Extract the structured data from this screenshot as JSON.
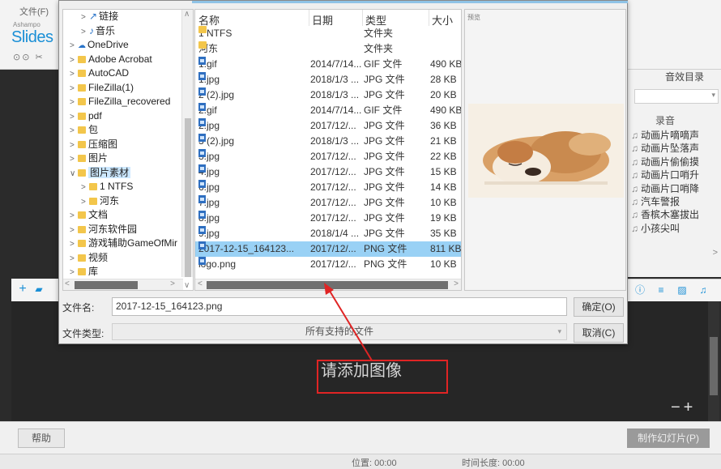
{
  "app": {
    "file_menu": "文件(F)",
    "brand_small": "Ashampo",
    "brand": "Slides",
    "controls": "⊙⊙ ✂",
    "sfx_title": "音效目录",
    "sfx_header": "录音",
    "sfx_items": [
      "动画片嘀嘀声",
      "动画片坠落声",
      "动画片偷偷摸",
      "动画片口哨升",
      "动画片口哨降",
      "汽车警报",
      "香槟木塞拔出",
      "小孩尖叫"
    ],
    "placeholder": "请添加图像",
    "zoom": "−+",
    "help_button": "帮助",
    "make_button": "制作幻灯片(P)",
    "status_position": "位置: 00:00",
    "status_duration": "时间长度: 00:00"
  },
  "dialog": {
    "tree": [
      {
        "label": "链接",
        "kind": "shortcut",
        "indent": 2,
        "chev": ">"
      },
      {
        "label": "音乐",
        "kind": "music",
        "indent": 2,
        "chev": ">"
      },
      {
        "label": "OneDrive",
        "kind": "cloud",
        "indent": 1,
        "chev": ">"
      },
      {
        "label": "Adobe Acrobat",
        "kind": "folder",
        "indent": 1,
        "chev": ">"
      },
      {
        "label": "AutoCAD",
        "kind": "folder",
        "indent": 1,
        "chev": ">"
      },
      {
        "label": "FileZilla(1)",
        "kind": "folder",
        "indent": 1,
        "chev": ">"
      },
      {
        "label": "FileZilla_recovered",
        "kind": "folder",
        "indent": 1,
        "chev": ">"
      },
      {
        "label": "pdf",
        "kind": "folder",
        "indent": 1,
        "chev": ">"
      },
      {
        "label": "包",
        "kind": "folder",
        "indent": 1,
        "chev": ">"
      },
      {
        "label": "压缩图",
        "kind": "folder",
        "indent": 1,
        "chev": ">"
      },
      {
        "label": "图片",
        "kind": "folder",
        "indent": 1,
        "chev": ">"
      },
      {
        "label": "图片素材",
        "kind": "folder",
        "indent": 1,
        "chev": "∨",
        "selected": true
      },
      {
        "label": "1 NTFS",
        "kind": "folder",
        "indent": 2,
        "chev": ">"
      },
      {
        "label": "河东",
        "kind": "folder",
        "indent": 2,
        "chev": ">"
      },
      {
        "label": "文档",
        "kind": "folder",
        "indent": 1,
        "chev": ">"
      },
      {
        "label": "河东软件园",
        "kind": "folder",
        "indent": 1,
        "chev": ">"
      },
      {
        "label": "游戏辅助GameOfMir",
        "kind": "folder",
        "indent": 1,
        "chev": ">"
      },
      {
        "label": "视频",
        "kind": "folder",
        "indent": 1,
        "chev": ">"
      },
      {
        "label": "库",
        "kind": "folder",
        "indent": 1,
        "chev": ">"
      }
    ],
    "columns": {
      "name": "名称",
      "date": "日期",
      "type": "类型",
      "size": "大小"
    },
    "files": [
      {
        "name": "1 NTFS",
        "date": "",
        "type": "文件夹",
        "size": "",
        "icon": "folder"
      },
      {
        "name": "河东",
        "date": "",
        "type": "文件夹",
        "size": "",
        "icon": "folder"
      },
      {
        "name": "1.gif",
        "date": "2014/7/14...",
        "type": "GIF 文件",
        "size": "490 KB",
        "icon": "img"
      },
      {
        "name": "1.jpg",
        "date": "2018/1/3 ...",
        "type": "JPG 文件",
        "size": "28 KB",
        "icon": "img"
      },
      {
        "name": "2 (2).jpg",
        "date": "2018/1/3 ...",
        "type": "JPG 文件",
        "size": "20 KB",
        "icon": "img"
      },
      {
        "name": "2.gif",
        "date": "2014/7/14...",
        "type": "GIF 文件",
        "size": "490 KB",
        "icon": "img"
      },
      {
        "name": "2.jpg",
        "date": "2017/12/...",
        "type": "JPG 文件",
        "size": "36 KB",
        "icon": "img"
      },
      {
        "name": "3 (2).jpg",
        "date": "2018/1/3 ...",
        "type": "JPG 文件",
        "size": "21 KB",
        "icon": "img"
      },
      {
        "name": "3.jpg",
        "date": "2017/12/...",
        "type": "JPG 文件",
        "size": "22 KB",
        "icon": "img"
      },
      {
        "name": "4.jpg",
        "date": "2017/12/...",
        "type": "JPG 文件",
        "size": "15 KB",
        "icon": "img"
      },
      {
        "name": "6.jpg",
        "date": "2017/12/...",
        "type": "JPG 文件",
        "size": "14 KB",
        "icon": "img"
      },
      {
        "name": "7.jpg",
        "date": "2017/12/...",
        "type": "JPG 文件",
        "size": "10 KB",
        "icon": "img"
      },
      {
        "name": "8.jpg",
        "date": "2017/12/...",
        "type": "JPG 文件",
        "size": "19 KB",
        "icon": "img"
      },
      {
        "name": "9.jpg",
        "date": "2018/1/4 ...",
        "type": "JPG 文件",
        "size": "35 KB",
        "icon": "img"
      },
      {
        "name": "2017-12-15_164123...",
        "date": "2017/12/...",
        "type": "PNG 文件",
        "size": "811 KB",
        "icon": "img",
        "selected": true
      },
      {
        "name": "logo.png",
        "date": "2017/12/...",
        "type": "PNG 文件",
        "size": "10 KB",
        "icon": "img"
      }
    ],
    "preview_label": "预览",
    "filename_label": "文件名:",
    "filename_value": "2017-12-15_164123.png",
    "ok_button": "确定(O)",
    "filetype_label": "文件类型:",
    "filetype_value": "所有支持的文件",
    "cancel_button": "取消(C)"
  },
  "colors": {
    "accent": "#1a8fd6",
    "selection": "#99d1f5",
    "annotation": "#e02424"
  }
}
